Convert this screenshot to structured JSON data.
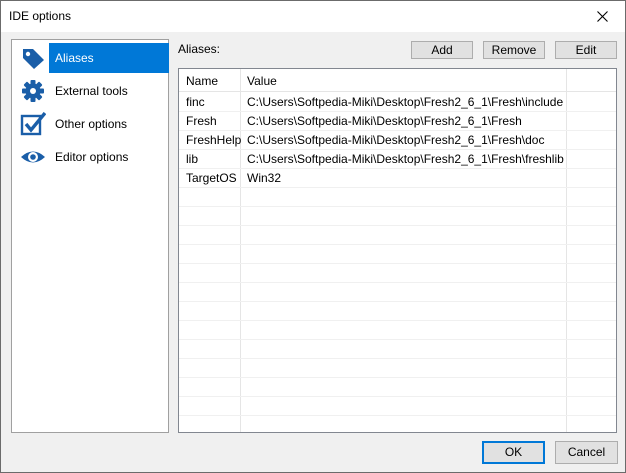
{
  "window": {
    "title": "IDE options"
  },
  "nav": {
    "items": [
      {
        "label": "Aliases",
        "icon": "tag-icon",
        "selected": true
      },
      {
        "label": "External tools",
        "icon": "gear-icon",
        "selected": false
      },
      {
        "label": "Other options",
        "icon": "checkbox-check-icon",
        "selected": false
      },
      {
        "label": "Editor options",
        "icon": "eye-icon",
        "selected": false
      }
    ]
  },
  "aliases": {
    "label": "Aliases:",
    "add_label": "Add",
    "remove_label": "Remove",
    "edit_label": "Edit",
    "columns": {
      "name": "Name",
      "value": "Value"
    },
    "rows": [
      {
        "name": "finc",
        "value": "C:\\Users\\Softpedia-Miki\\Desktop\\Fresh2_6_1\\Fresh\\include"
      },
      {
        "name": "Fresh",
        "value": "C:\\Users\\Softpedia-Miki\\Desktop\\Fresh2_6_1\\Fresh"
      },
      {
        "name": "FreshHelp",
        "value": "C:\\Users\\Softpedia-Miki\\Desktop\\Fresh2_6_1\\Fresh\\doc"
      },
      {
        "name": "lib",
        "value": "C:\\Users\\Softpedia-Miki\\Desktop\\Fresh2_6_1\\Fresh\\freshlib"
      },
      {
        "name": "TargetOS",
        "value": "Win32"
      }
    ]
  },
  "footer": {
    "ok_label": "OK",
    "cancel_label": "Cancel"
  },
  "colors": {
    "accent": "#0078d7",
    "icon": "#1a5ea8",
    "window_bg": "#f0f0f0"
  }
}
